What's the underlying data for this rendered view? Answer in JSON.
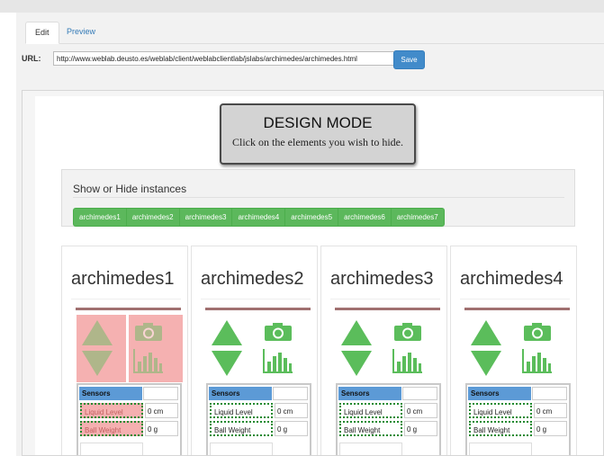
{
  "tabs": [
    {
      "label": "Edit"
    },
    {
      "label": "Preview"
    }
  ],
  "url_bar": {
    "label": "URL:",
    "value": "http://www.weblab.deusto.es/weblab/client/weblabclientlab/jslabs/archimedes/archimedes.html",
    "save_label": "Save"
  },
  "design_mode": {
    "title": "DESIGN MODE",
    "subtitle": "Click on the elements you wish to hide."
  },
  "show_hide": {
    "title": "Show or Hide instances",
    "instances": [
      "archimedes1",
      "archimedes2",
      "archimedes3",
      "archimedes4",
      "archimedes5",
      "archimedes6",
      "archimedes7"
    ]
  },
  "cards": [
    {
      "name": "archimedes1",
      "sensors_title": "Sensors",
      "liquid_label": "Liquid Level",
      "liquid_value": "0 cm",
      "weight_label": "Ball Weight",
      "weight_value": "0 g",
      "hidden": true
    },
    {
      "name": "archimedes2",
      "sensors_title": "Sensors",
      "liquid_label": "Liquid Level",
      "liquid_value": "0 cm",
      "weight_label": "Ball Weight",
      "weight_value": "0 g",
      "hidden": false
    },
    {
      "name": "archimedes3",
      "sensors_title": "Sensors",
      "liquid_label": "Liquid Level",
      "liquid_value": "0 cm",
      "weight_label": "Ball Weight",
      "weight_value": "0 g",
      "hidden": false
    },
    {
      "name": "archimedes4",
      "sensors_title": "Sensors",
      "liquid_label": "Liquid Level",
      "liquid_value": "0 cm",
      "weight_label": "Ball Weight",
      "weight_value": "0 g",
      "hidden": false
    }
  ],
  "colors": {
    "accent": "#428bca",
    "instance_buttons": "#5cb85c",
    "arrows": "#5bbd5b",
    "hidden_highlight": "#f3a3a3",
    "sensor_header": "#5c9ad6"
  },
  "icons": {
    "up": "arrow-up-icon",
    "down": "arrow-down-icon",
    "camera": "camera-icon",
    "chart": "bar-chart-icon"
  }
}
